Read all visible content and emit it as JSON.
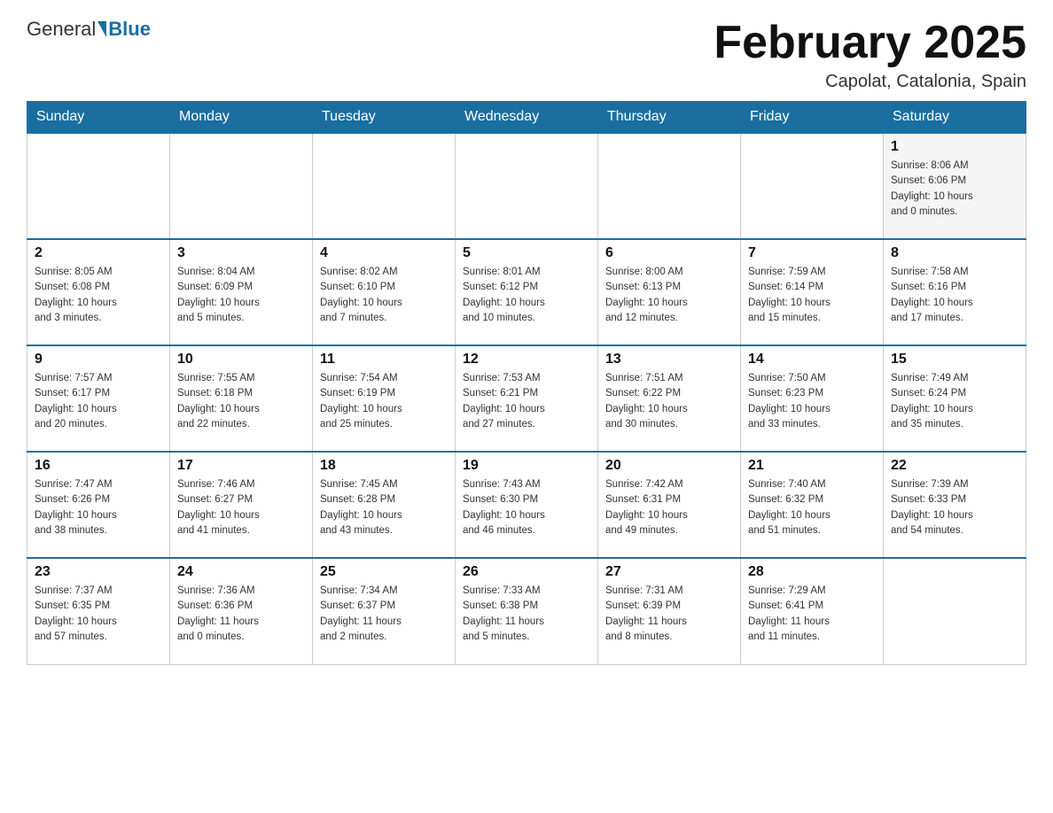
{
  "header": {
    "logo_general": "General",
    "logo_blue": "Blue",
    "month_title": "February 2025",
    "location": "Capolat, Catalonia, Spain"
  },
  "days_of_week": [
    "Sunday",
    "Monday",
    "Tuesday",
    "Wednesday",
    "Thursday",
    "Friday",
    "Saturday"
  ],
  "weeks": [
    [
      {
        "day": "",
        "info": ""
      },
      {
        "day": "",
        "info": ""
      },
      {
        "day": "",
        "info": ""
      },
      {
        "day": "",
        "info": ""
      },
      {
        "day": "",
        "info": ""
      },
      {
        "day": "",
        "info": ""
      },
      {
        "day": "1",
        "info": "Sunrise: 8:06 AM\nSunset: 6:06 PM\nDaylight: 10 hours\nand 0 minutes."
      }
    ],
    [
      {
        "day": "2",
        "info": "Sunrise: 8:05 AM\nSunset: 6:08 PM\nDaylight: 10 hours\nand 3 minutes."
      },
      {
        "day": "3",
        "info": "Sunrise: 8:04 AM\nSunset: 6:09 PM\nDaylight: 10 hours\nand 5 minutes."
      },
      {
        "day": "4",
        "info": "Sunrise: 8:02 AM\nSunset: 6:10 PM\nDaylight: 10 hours\nand 7 minutes."
      },
      {
        "day": "5",
        "info": "Sunrise: 8:01 AM\nSunset: 6:12 PM\nDaylight: 10 hours\nand 10 minutes."
      },
      {
        "day": "6",
        "info": "Sunrise: 8:00 AM\nSunset: 6:13 PM\nDaylight: 10 hours\nand 12 minutes."
      },
      {
        "day": "7",
        "info": "Sunrise: 7:59 AM\nSunset: 6:14 PM\nDaylight: 10 hours\nand 15 minutes."
      },
      {
        "day": "8",
        "info": "Sunrise: 7:58 AM\nSunset: 6:16 PM\nDaylight: 10 hours\nand 17 minutes."
      }
    ],
    [
      {
        "day": "9",
        "info": "Sunrise: 7:57 AM\nSunset: 6:17 PM\nDaylight: 10 hours\nand 20 minutes."
      },
      {
        "day": "10",
        "info": "Sunrise: 7:55 AM\nSunset: 6:18 PM\nDaylight: 10 hours\nand 22 minutes."
      },
      {
        "day": "11",
        "info": "Sunrise: 7:54 AM\nSunset: 6:19 PM\nDaylight: 10 hours\nand 25 minutes."
      },
      {
        "day": "12",
        "info": "Sunrise: 7:53 AM\nSunset: 6:21 PM\nDaylight: 10 hours\nand 27 minutes."
      },
      {
        "day": "13",
        "info": "Sunrise: 7:51 AM\nSunset: 6:22 PM\nDaylight: 10 hours\nand 30 minutes."
      },
      {
        "day": "14",
        "info": "Sunrise: 7:50 AM\nSunset: 6:23 PM\nDaylight: 10 hours\nand 33 minutes."
      },
      {
        "day": "15",
        "info": "Sunrise: 7:49 AM\nSunset: 6:24 PM\nDaylight: 10 hours\nand 35 minutes."
      }
    ],
    [
      {
        "day": "16",
        "info": "Sunrise: 7:47 AM\nSunset: 6:26 PM\nDaylight: 10 hours\nand 38 minutes."
      },
      {
        "day": "17",
        "info": "Sunrise: 7:46 AM\nSunset: 6:27 PM\nDaylight: 10 hours\nand 41 minutes."
      },
      {
        "day": "18",
        "info": "Sunrise: 7:45 AM\nSunset: 6:28 PM\nDaylight: 10 hours\nand 43 minutes."
      },
      {
        "day": "19",
        "info": "Sunrise: 7:43 AM\nSunset: 6:30 PM\nDaylight: 10 hours\nand 46 minutes."
      },
      {
        "day": "20",
        "info": "Sunrise: 7:42 AM\nSunset: 6:31 PM\nDaylight: 10 hours\nand 49 minutes."
      },
      {
        "day": "21",
        "info": "Sunrise: 7:40 AM\nSunset: 6:32 PM\nDaylight: 10 hours\nand 51 minutes."
      },
      {
        "day": "22",
        "info": "Sunrise: 7:39 AM\nSunset: 6:33 PM\nDaylight: 10 hours\nand 54 minutes."
      }
    ],
    [
      {
        "day": "23",
        "info": "Sunrise: 7:37 AM\nSunset: 6:35 PM\nDaylight: 10 hours\nand 57 minutes."
      },
      {
        "day": "24",
        "info": "Sunrise: 7:36 AM\nSunset: 6:36 PM\nDaylight: 11 hours\nand 0 minutes."
      },
      {
        "day": "25",
        "info": "Sunrise: 7:34 AM\nSunset: 6:37 PM\nDaylight: 11 hours\nand 2 minutes."
      },
      {
        "day": "26",
        "info": "Sunrise: 7:33 AM\nSunset: 6:38 PM\nDaylight: 11 hours\nand 5 minutes."
      },
      {
        "day": "27",
        "info": "Sunrise: 7:31 AM\nSunset: 6:39 PM\nDaylight: 11 hours\nand 8 minutes."
      },
      {
        "day": "28",
        "info": "Sunrise: 7:29 AM\nSunset: 6:41 PM\nDaylight: 11 hours\nand 11 minutes."
      },
      {
        "day": "",
        "info": ""
      }
    ]
  ]
}
